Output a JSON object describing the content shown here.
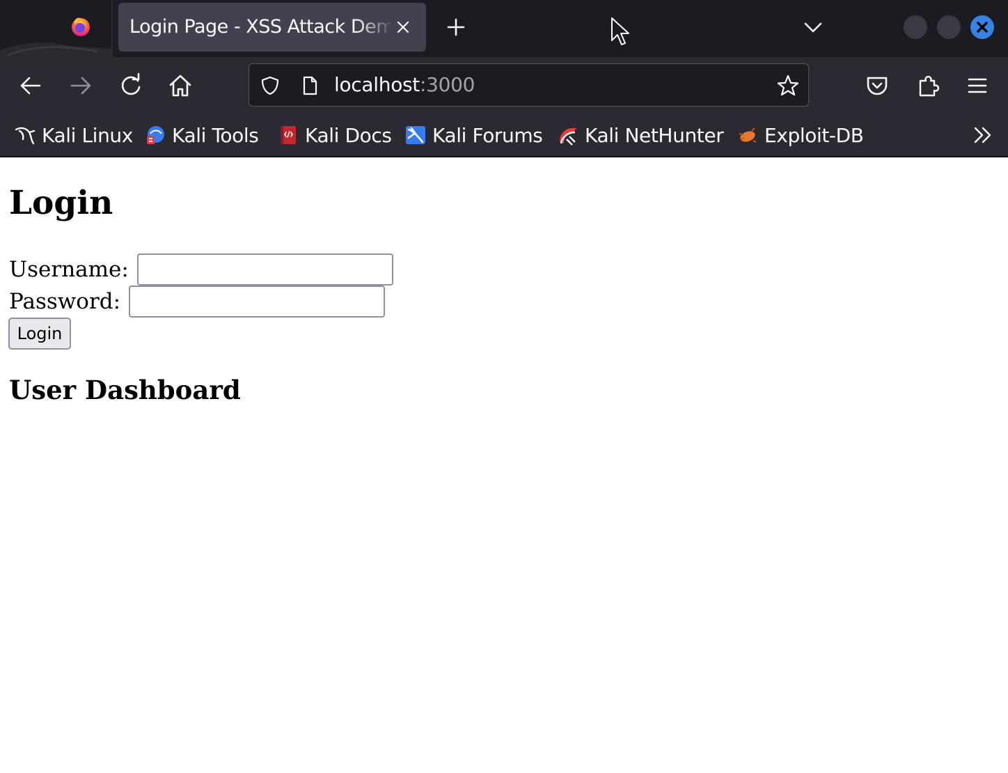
{
  "browser": {
    "tab": {
      "title": "Login Page - XSS Attack Demo"
    },
    "url": {
      "host": "localhost",
      "port": ":3000"
    },
    "bookmarks": [
      {
        "label": "Kali Linux",
        "icon": "kali-dragon-icon"
      },
      {
        "label": "Kali Tools",
        "icon": "kali-tools-icon"
      },
      {
        "label": "Kali Docs",
        "icon": "kali-docs-icon"
      },
      {
        "label": "Kali Forums",
        "icon": "kali-forums-icon"
      },
      {
        "label": "Kali NetHunter",
        "icon": "kali-nethunter-icon"
      },
      {
        "label": "Exploit-DB",
        "icon": "exploit-db-icon"
      }
    ],
    "colors": {
      "chrome_dark": "#1c1b22",
      "toolbar": "#2b2a33",
      "tab_active": "#42414d",
      "close_accent": "#3584e4"
    }
  },
  "page": {
    "heading": "Login",
    "username_label": "Username:",
    "username_value": "",
    "password_label": "Password:",
    "password_value": "",
    "login_button": "Login",
    "dashboard_heading": "User Dashboard"
  }
}
